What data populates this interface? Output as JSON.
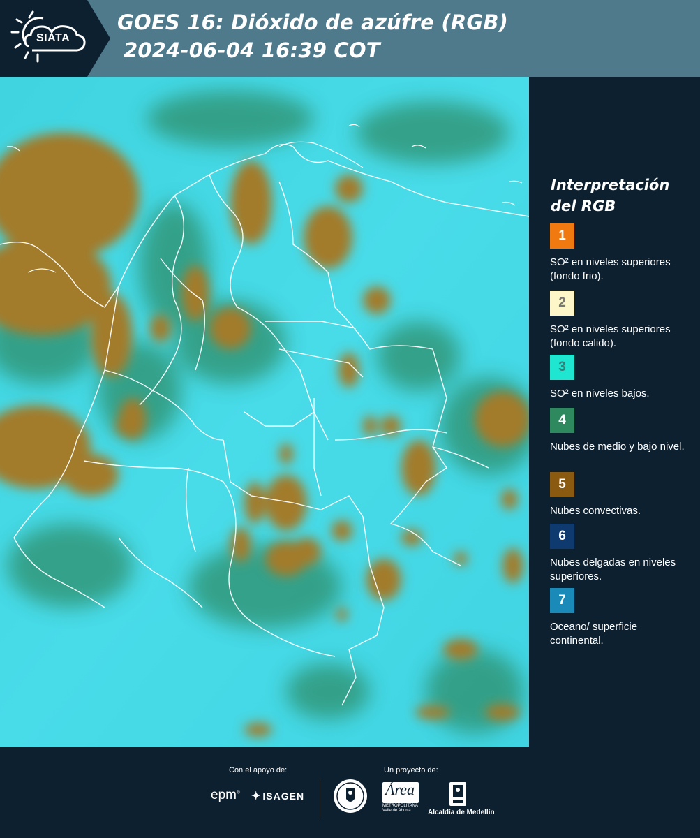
{
  "header": {
    "logo_text": "SIATA",
    "title_line1": "GOES 16: Dióxido de azúfre (RGB)",
    "title_line2": "2024-06-04 16:39 COT"
  },
  "map": {
    "background_color": "#42d8e6",
    "cloud_colors": {
      "convective": "#a07a28",
      "low_mid": "#2e8a6a",
      "borders": "#ffffff"
    }
  },
  "legend": {
    "title": "Interpretación del RGB",
    "items": [
      {
        "number": "1",
        "color": "#f07a10",
        "text_color": "#ffffff",
        "label": "SO² en niveles superiores (fondo frio)."
      },
      {
        "number": "2",
        "color": "#fdf6c8",
        "text_color": "#777777",
        "label": "SO² en niveles superiores (fondo calido)."
      },
      {
        "number": "3",
        "color": "#1ee6d0",
        "text_color": "#3a7d78",
        "label": "SO² en niveles bajos."
      },
      {
        "number": "4",
        "color": "#2e8a5e",
        "text_color": "#ffffff",
        "label": "Nubes de medio y bajo nivel."
      },
      {
        "number": "5",
        "color": "#8a5a10",
        "text_color": "#ffffff",
        "label": "Nubes convectivas."
      },
      {
        "number": "6",
        "color": "#0e3a70",
        "text_color": "#ffffff",
        "label": "Nubes delgadas en niveles superiores."
      },
      {
        "number": "7",
        "color": "#1a8ab8",
        "text_color": "#ffffff",
        "label": "Oceano/ superficie continental."
      }
    ]
  },
  "footer": {
    "support_caption": "Con el apoyo de:",
    "project_caption": "Un proyecto de:",
    "epm": "epm",
    "isagen": "ISAGEN",
    "area_name": "Área",
    "area_sub1": "METROPOLITANA",
    "area_sub2": "Valle de Aburrá",
    "medellin": "Alcaldía de Medellín"
  }
}
